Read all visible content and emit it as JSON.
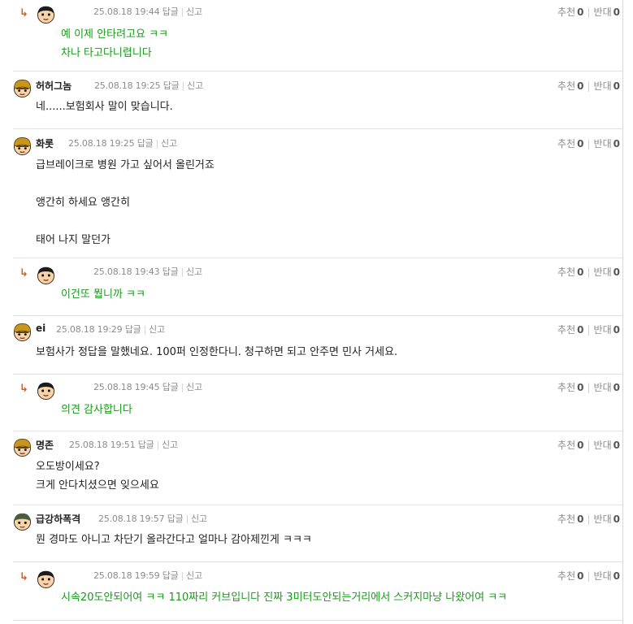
{
  "icons": {
    "reply_arrow": "reply-arrow-icon",
    "avatar": "avatar-icon"
  },
  "colors": {
    "reply_text": "#1a9a1a",
    "arrow": "#e05a17",
    "meta": "#8c8c8c"
  },
  "labels": {
    "reply": "답글",
    "report": "신고",
    "recommend": "추천",
    "oppose": "반대"
  },
  "comments": [
    {
      "nick": "",
      "date": "25.08.18 19:44",
      "up": "0",
      "down": "0",
      "lines": [
        "예 이제 안타려고요 ㅋㅋ",
        "차나 타고다니렵니다"
      ]
    },
    {
      "nick": "허허그놈",
      "date": "25.08.18 19:25",
      "up": "0",
      "down": "0",
      "lines": [
        "네......보험회사 말이 맞습니다."
      ]
    },
    {
      "nick": "화롯",
      "date": "25.08.18 19:25",
      "up": "0",
      "down": "0",
      "lines": [
        "급브레이크로 병원 가고 싶어서 올린거죠",
        "앵간히 하세요 앵간히",
        "태어 나지 말던가"
      ]
    },
    {
      "nick": "",
      "date": "25.08.18 19:43",
      "up": "0",
      "down": "0",
      "lines": [
        "이건또 뭡니까 ㅋㅋ"
      ]
    },
    {
      "nick": "ei",
      "date": "25.08.18 19:29",
      "up": "0",
      "down": "0",
      "lines": [
        "보험사가 정답을 말했네요. 100퍼 인정한다니. 청구하면 되고 안주면 민사 거세요."
      ]
    },
    {
      "nick": "",
      "date": "25.08.18 19:45",
      "up": "0",
      "down": "0",
      "lines": [
        "의견 감사합니다"
      ]
    },
    {
      "nick": "명존",
      "date": "25.08.18 19:51",
      "up": "0",
      "down": "0",
      "lines": [
        "오도방이세요?",
        "크게 안다치셨으면 잊으세요"
      ]
    },
    {
      "nick": "급강하폭격",
      "date": "25.08.18 19:57",
      "up": "0",
      "down": "0",
      "lines": [
        "뭔 경마도 아니고 차단기 올라간다고 얼마나 감아제낀게 ㅋㅋㅋ"
      ]
    },
    {
      "nick": "",
      "date": "25.08.18 19:59",
      "up": "0",
      "down": "0",
      "lines": [
        "시속20도안되어여 ㅋㅋ 110짜리 커브입니다 진짜 3미터도안되는거리에서 스커지마냥 나왔어여 ㅋㅋ"
      ]
    }
  ]
}
